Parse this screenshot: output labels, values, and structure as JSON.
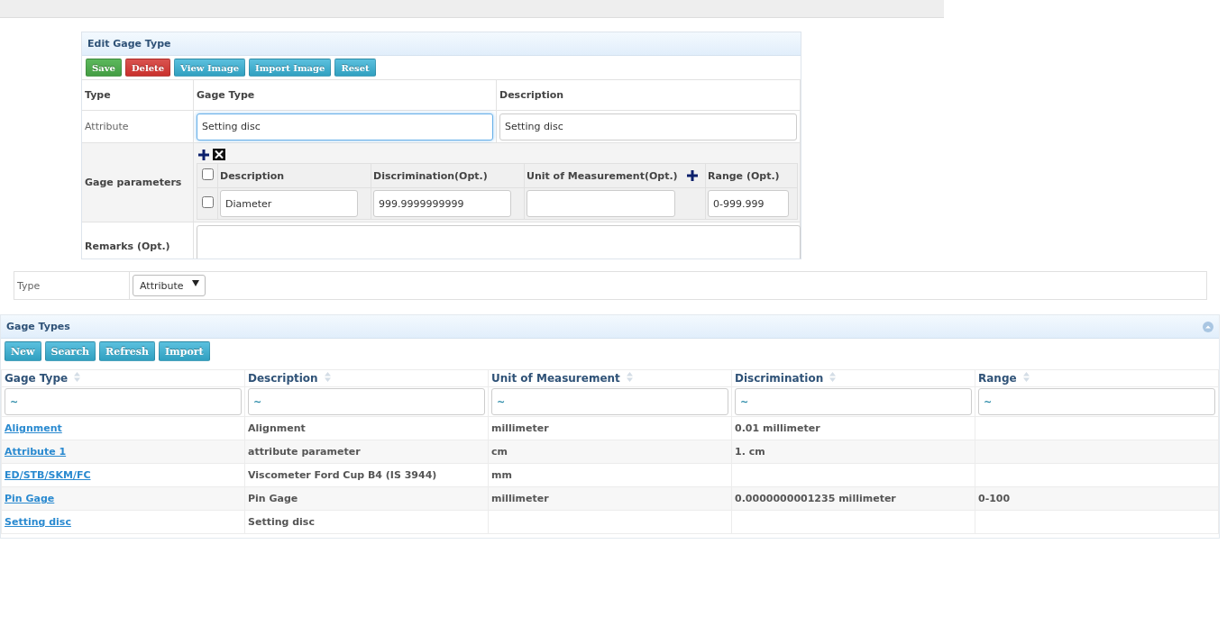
{
  "edit_panel": {
    "title": "Edit Gage Type",
    "buttons": [
      {
        "label": "Save",
        "kind": "success"
      },
      {
        "label": "Delete",
        "kind": "danger"
      },
      {
        "label": "View Image",
        "kind": "info"
      },
      {
        "label": "Import Image",
        "kind": "info"
      },
      {
        "label": "Reset",
        "kind": "info"
      }
    ],
    "type_label": "Type",
    "gage_type_label": "Gage Type",
    "description_label": "Description",
    "type_value": "Attribute",
    "gage_type_field": {
      "value": "Setting disc",
      "focused": true
    },
    "description_field": {
      "value": "Setting disc",
      "focused": false
    },
    "parameters_label": "Gage parameters",
    "parameters": {
      "columns": [
        "Description",
        "Discrimination(Opt.)",
        "Unit of Measurement(Opt.)",
        "Range (Opt.)"
      ],
      "select_all_checked": false,
      "rows": [
        {
          "checked": false,
          "description": "Diameter",
          "discrimination": "999.9999999999",
          "range": "0-999.999"
        }
      ]
    },
    "remarks_label": "Remarks (Opt.)"
  },
  "type_filter": {
    "label": "Type",
    "value": "Attribute"
  },
  "gage_types": {
    "title": "Gage Types",
    "buttons": [
      "New",
      "Search",
      "Refresh",
      "Import"
    ],
    "columns": [
      {
        "label": "Gage Type",
        "filter": "~"
      },
      {
        "label": "Description",
        "filter": "~"
      },
      {
        "label": "Unit of Measurement",
        "filter": "~"
      },
      {
        "label": "Discrimination",
        "filter": "~"
      },
      {
        "label": "Range",
        "filter": "~"
      }
    ],
    "rows": [
      {
        "cells": [
          "Alignment",
          "Alignment",
          "millimeter",
          "0.01 millimeter",
          null
        ]
      },
      {
        "cells": [
          "Attribute 1",
          "attribute parameter",
          "cm",
          "1. cm",
          null
        ]
      },
      {
        "cells": [
          "ED/STB/SKM/FC",
          "Viscometer Ford Cup B4 (IS 3944)",
          "mm",
          null,
          null
        ]
      },
      {
        "cells": [
          "Pin Gage",
          "Pin Gage",
          "millimeter",
          "0.0000000001235 millimeter",
          "0-100"
        ]
      },
      {
        "cells": [
          "Setting disc",
          "Setting disc",
          null,
          null,
          null
        ]
      }
    ]
  }
}
